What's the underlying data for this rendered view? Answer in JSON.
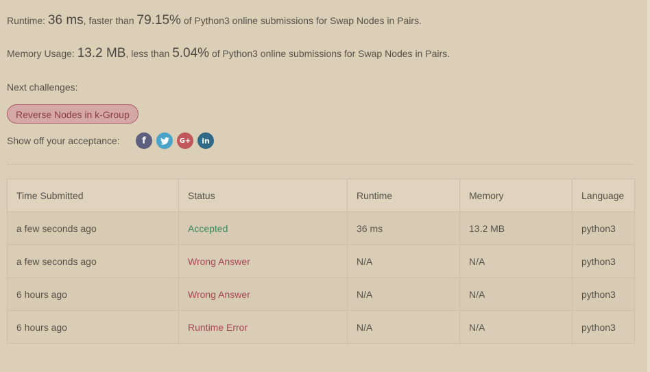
{
  "summary": {
    "runtime_label": "Runtime:",
    "runtime_value": "36 ms",
    "runtime_faster": ", faster than",
    "runtime_percent": "79.15%",
    "runtime_suffix": "of Python3 online submissions for Swap Nodes in Pairs.",
    "memory_label": "Memory Usage:",
    "memory_value": "13.2 MB",
    "memory_less": ", less than",
    "memory_percent": "5.04%",
    "memory_suffix": "of Python3 online submissions for Swap Nodes in Pairs."
  },
  "next_challenges": {
    "label": "Next challenges:",
    "items": [
      "Reverse Nodes in k-Group"
    ]
  },
  "share": {
    "label": "Show off your acceptance:",
    "icons": [
      "facebook-icon",
      "twitter-icon",
      "google-plus-icon",
      "linkedin-icon"
    ],
    "glyphs": [
      "f",
      "🐦",
      "G+",
      "in"
    ]
  },
  "table": {
    "headers": [
      "Time Submitted",
      "Status",
      "Runtime",
      "Memory",
      "Language"
    ],
    "rows": [
      {
        "time": "a few seconds ago",
        "status": "Accepted",
        "runtime": "36 ms",
        "memory": "13.2 MB",
        "language": "python3"
      },
      {
        "time": "a few seconds ago",
        "status": "Wrong Answer",
        "runtime": "N/A",
        "memory": "N/A",
        "language": "python3"
      },
      {
        "time": "6 hours ago",
        "status": "Wrong Answer",
        "runtime": "N/A",
        "memory": "N/A",
        "language": "python3"
      },
      {
        "time": "6 hours ago",
        "status": "Runtime Error",
        "runtime": "N/A",
        "memory": "N/A",
        "language": "python3"
      }
    ]
  },
  "colors": {
    "background": "#dccfb8",
    "accepted": "#3e8a5a",
    "error": "#a8474e",
    "chip_bg": "#d3a8a6",
    "chip_text": "#8b3a45"
  }
}
